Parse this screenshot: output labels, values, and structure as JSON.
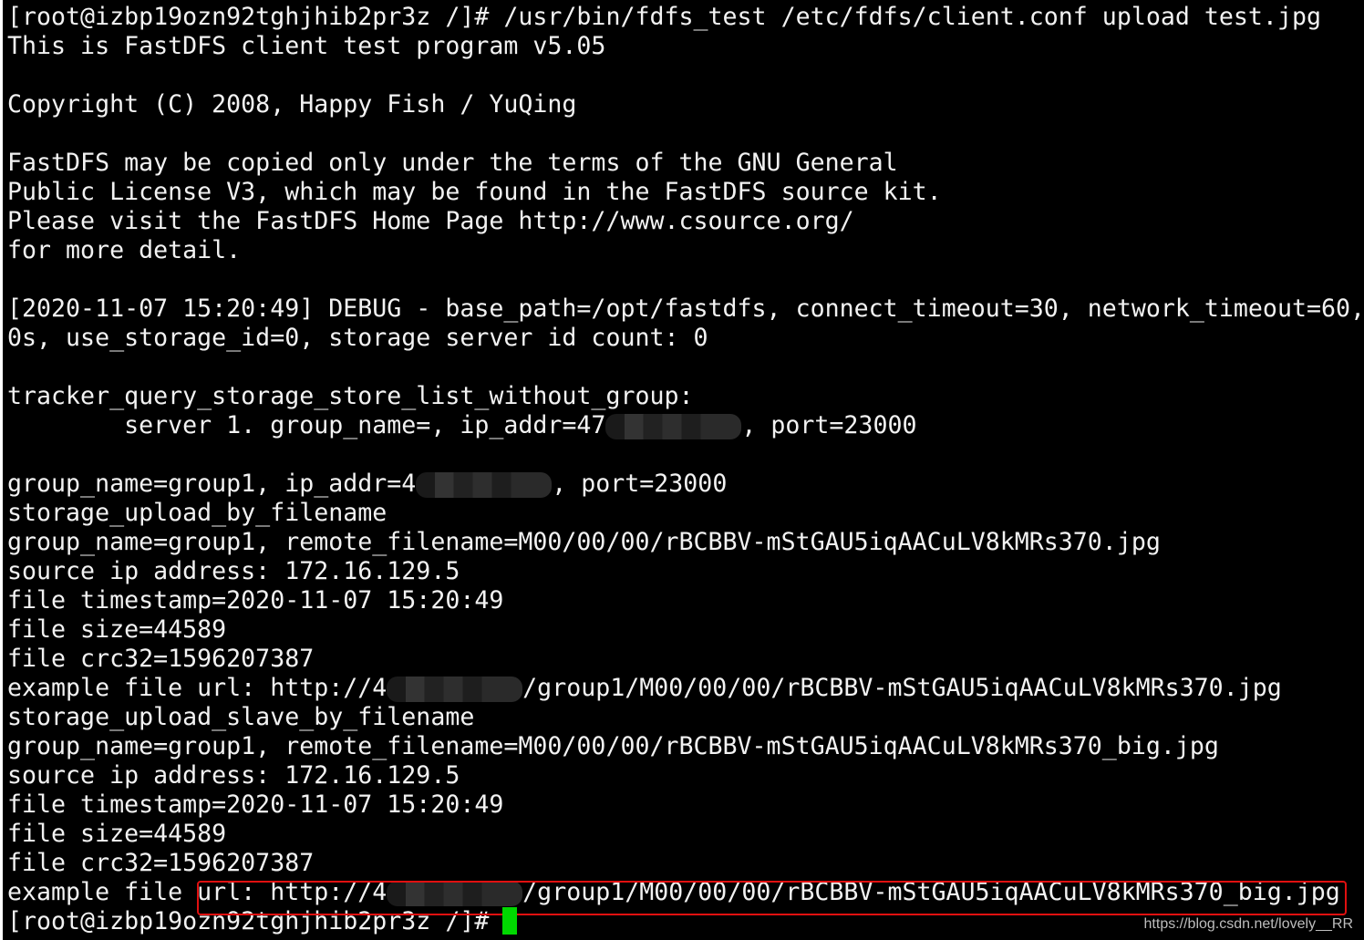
{
  "colors": {
    "background": "#000000",
    "text": "#f2f2f2",
    "cursor": "#00d800",
    "highlight_box": "#e01010"
  },
  "lines": [
    {
      "pre": "[root@izbp19ozn92tghjhib2pr3z /]# /usr/bin/fdfs_test /etc/fdfs/client.conf upload test.jpg"
    },
    {
      "pre": "This is FastDFS client test program v5.05"
    },
    {
      "pre": ""
    },
    {
      "pre": "Copyright (C) 2008, Happy Fish / YuQing"
    },
    {
      "pre": ""
    },
    {
      "pre": "FastDFS may be copied only under the terms of the GNU General"
    },
    {
      "pre": "Public License V3, which may be found in the FastDFS source kit."
    },
    {
      "pre": "Please visit the FastDFS Home Page http://www.csource.org/"
    },
    {
      "pre": "for more detail."
    },
    {
      "pre": ""
    },
    {
      "pre": "[2020-11-07 15:20:49] DEBUG - base_path=/opt/fastdfs, connect_timeout=30, network_timeout=60,"
    },
    {
      "pre": "0s, use_storage_id=0, storage server id count: 0"
    },
    {
      "pre": ""
    },
    {
      "pre": "tracker_query_storage_store_list_without_group:"
    },
    {
      "pre": "        server 1. group_name=, ip_addr=47",
      "masked": true,
      "post": ", port=23000"
    },
    {
      "pre": ""
    },
    {
      "pre": "group_name=group1, ip_addr=4",
      "masked": true,
      "post": ", port=23000"
    },
    {
      "pre": "storage_upload_by_filename"
    },
    {
      "pre": "group_name=group1, remote_filename=M00/00/00/rBCBBV-mStGAU5iqAACuLV8kMRs370.jpg"
    },
    {
      "pre": "source ip address: 172.16.129.5"
    },
    {
      "pre": "file timestamp=2020-11-07 15:20:49"
    },
    {
      "pre": "file size=44589"
    },
    {
      "pre": "file crc32=1596207387"
    },
    {
      "pre": "example file url: http://4",
      "masked": true,
      "post": "/group1/M00/00/00/rBCBBV-mStGAU5iqAACuLV8kMRs370.jpg"
    },
    {
      "pre": "storage_upload_slave_by_filename"
    },
    {
      "pre": "group_name=group1, remote_filename=M00/00/00/rBCBBV-mStGAU5iqAACuLV8kMRs370_big.jpg"
    },
    {
      "pre": "source ip address: 172.16.129.5"
    },
    {
      "pre": "file timestamp=2020-11-07 15:20:49"
    },
    {
      "pre": "file size=44589"
    },
    {
      "pre": "file crc32=1596207387"
    },
    {
      "pre": "example file url: http://4",
      "masked": true,
      "post": "/group1/M00/00/00/rBCBBV-mStGAU5iqAACuLV8kMRs370_big.jpg"
    },
    {
      "pre": "[root@izbp19ozn92tghjhib2pr3z /]# "
    }
  ],
  "watermark": "https://blog.csdn.net/lovely__RR"
}
